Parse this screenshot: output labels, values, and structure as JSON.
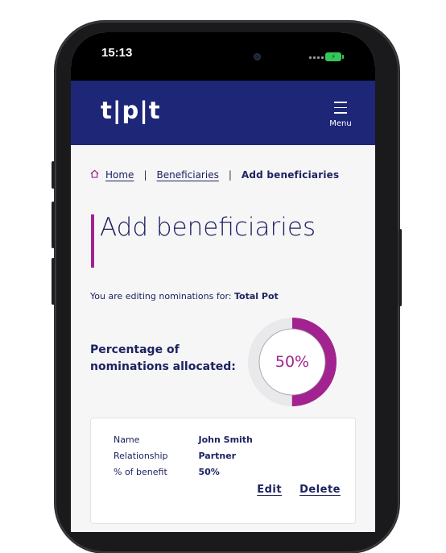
{
  "status_bar": {
    "time": "15:13",
    "battery_icon": "battery-charging-icon",
    "battery_color": "#34c759"
  },
  "header": {
    "logo": "tpt",
    "menu_label": "Menu",
    "background_color": "#1d2677"
  },
  "breadcrumb": {
    "home": "Home",
    "separator": "|",
    "beneficiaries": "Beneficiaries",
    "current": "Add beneficiaries"
  },
  "page": {
    "title": "Add beneficiaries",
    "accent_color": "#a2238f",
    "editing_prefix": "You are editing nominations for:",
    "editing_target": "Total Pot"
  },
  "allocation": {
    "label": "Percentage of nominations allocated:",
    "percent_label": "50%",
    "fraction": 0.5
  },
  "beneficiary": {
    "name_label": "Name",
    "name": "John Smith",
    "relationship_label": "Relationship",
    "relationship": "Partner",
    "benefit_label": "% of benefit",
    "benefit": "50%",
    "edit": "Edit",
    "delete": "Delete"
  }
}
